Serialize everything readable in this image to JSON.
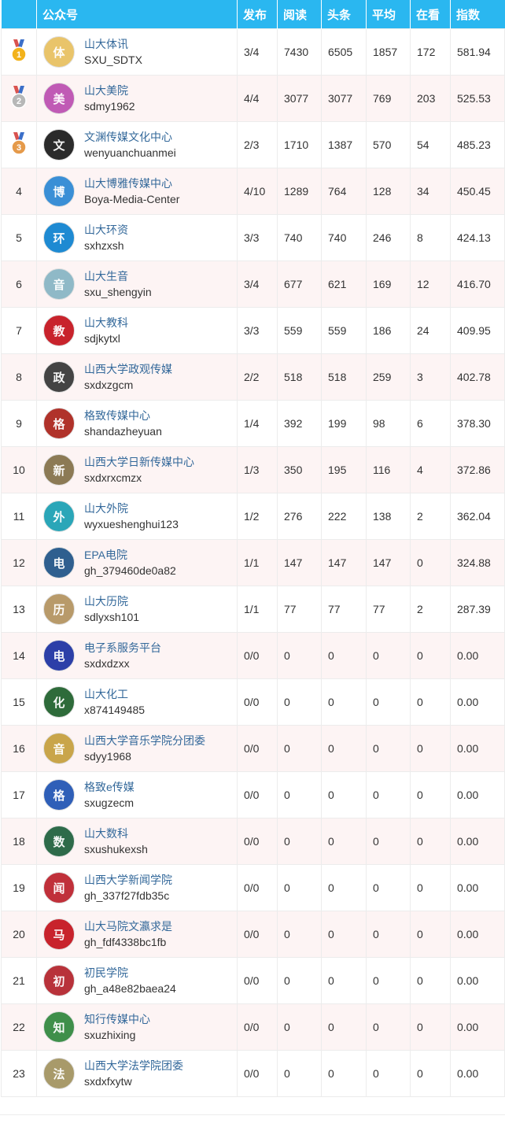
{
  "header": {
    "account": "公众号",
    "publish": "发布",
    "reads": "阅读",
    "headline": "头条",
    "average": "平均",
    "watching": "在看",
    "index": "指数"
  },
  "rows": [
    {
      "rank": "1",
      "medal": "gold",
      "name": "山大体讯",
      "id": "SXU_SDTX",
      "publish": "3/4",
      "reads": "7430",
      "headline": "6505",
      "average": "1857",
      "watching": "172",
      "index": "581.94",
      "avatar_color": "#e9c46a",
      "avatar_glyph": "体"
    },
    {
      "rank": "2",
      "medal": "silver",
      "name": "山大美院",
      "id": "sdmy1962",
      "publish": "4/4",
      "reads": "3077",
      "headline": "3077",
      "average": "769",
      "watching": "203",
      "index": "525.53",
      "avatar_color": "#c05ab5",
      "avatar_glyph": "美"
    },
    {
      "rank": "3",
      "medal": "bronze",
      "name": "文渊传媒文化中心",
      "id": "wenyuanchuanmei",
      "publish": "2/3",
      "reads": "1710",
      "headline": "1387",
      "average": "570",
      "watching": "54",
      "index": "485.23",
      "avatar_color": "#2b2b2b",
      "avatar_glyph": "文"
    },
    {
      "rank": "4",
      "medal": "",
      "name": "山大博雅传媒中心",
      "id": "Boya-Media-Center",
      "publish": "4/10",
      "reads": "1289",
      "headline": "764",
      "average": "128",
      "watching": "34",
      "index": "450.45",
      "avatar_color": "#3a8fd6",
      "avatar_glyph": "博"
    },
    {
      "rank": "5",
      "medal": "",
      "name": "山大环资",
      "id": "sxhzxsh",
      "publish": "3/3",
      "reads": "740",
      "headline": "740",
      "average": "246",
      "watching": "8",
      "index": "424.13",
      "avatar_color": "#1e8ad2",
      "avatar_glyph": "环"
    },
    {
      "rank": "6",
      "medal": "",
      "name": "山大生音",
      "id": "sxu_shengyin",
      "publish": "3/4",
      "reads": "677",
      "headline": "621",
      "average": "169",
      "watching": "12",
      "index": "416.70",
      "avatar_color": "#8fb9c7",
      "avatar_glyph": "音"
    },
    {
      "rank": "7",
      "medal": "",
      "name": "山大教科",
      "id": "sdjkytxl",
      "publish": "3/3",
      "reads": "559",
      "headline": "559",
      "average": "186",
      "watching": "24",
      "index": "409.95",
      "avatar_color": "#c8232c",
      "avatar_glyph": "教"
    },
    {
      "rank": "8",
      "medal": "",
      "name": "山西大学政观传媒",
      "id": "sxdxzgcm",
      "publish": "2/2",
      "reads": "518",
      "headline": "518",
      "average": "259",
      "watching": "3",
      "index": "402.78",
      "avatar_color": "#444444",
      "avatar_glyph": "政"
    },
    {
      "rank": "9",
      "medal": "",
      "name": "格致传媒中心",
      "id": "shandazheyuan",
      "publish": "1/4",
      "reads": "392",
      "headline": "199",
      "average": "98",
      "watching": "6",
      "index": "378.30",
      "avatar_color": "#b0322a",
      "avatar_glyph": "格"
    },
    {
      "rank": "10",
      "medal": "",
      "name": "山西大学日新传媒中心",
      "id": "sxdxrxcmzx",
      "publish": "1/3",
      "reads": "350",
      "headline": "195",
      "average": "116",
      "watching": "4",
      "index": "372.86",
      "avatar_color": "#8c7a55",
      "avatar_glyph": "新"
    },
    {
      "rank": "11",
      "medal": "",
      "name": "山大外院",
      "id": "wyxueshenghui123",
      "publish": "1/2",
      "reads": "276",
      "headline": "222",
      "average": "138",
      "watching": "2",
      "index": "362.04",
      "avatar_color": "#2aa6b8",
      "avatar_glyph": "外"
    },
    {
      "rank": "12",
      "medal": "",
      "name": "EPA电院",
      "id": "gh_379460de0a82",
      "publish": "1/1",
      "reads": "147",
      "headline": "147",
      "average": "147",
      "watching": "0",
      "index": "324.88",
      "avatar_color": "#2f5f8f",
      "avatar_glyph": "电"
    },
    {
      "rank": "13",
      "medal": "",
      "name": "山大历院",
      "id": "sdlyxsh101",
      "publish": "1/1",
      "reads": "77",
      "headline": "77",
      "average": "77",
      "watching": "2",
      "index": "287.39",
      "avatar_color": "#b89a6a",
      "avatar_glyph": "历"
    },
    {
      "rank": "14",
      "medal": "",
      "name": "电子系服务平台",
      "id": "sxdxdzxx",
      "publish": "0/0",
      "reads": "0",
      "headline": "0",
      "average": "0",
      "watching": "0",
      "index": "0.00",
      "avatar_color": "#2c3fa8",
      "avatar_glyph": "电"
    },
    {
      "rank": "15",
      "medal": "",
      "name": "山大化工",
      "id": "x874149485",
      "publish": "0/0",
      "reads": "0",
      "headline": "0",
      "average": "0",
      "watching": "0",
      "index": "0.00",
      "avatar_color": "#2e6b3a",
      "avatar_glyph": "化"
    },
    {
      "rank": "16",
      "medal": "",
      "name": "山西大学音乐学院分团委",
      "id": "sdyy1968",
      "publish": "0/0",
      "reads": "0",
      "headline": "0",
      "average": "0",
      "watching": "0",
      "index": "0.00",
      "avatar_color": "#c9a54a",
      "avatar_glyph": "音"
    },
    {
      "rank": "17",
      "medal": "",
      "name": "格致e传媒",
      "id": "sxugzecm",
      "publish": "0/0",
      "reads": "0",
      "headline": "0",
      "average": "0",
      "watching": "0",
      "index": "0.00",
      "avatar_color": "#2f5fb8",
      "avatar_glyph": "格"
    },
    {
      "rank": "18",
      "medal": "",
      "name": "山大数科",
      "id": "sxushukexsh",
      "publish": "0/0",
      "reads": "0",
      "headline": "0",
      "average": "0",
      "watching": "0",
      "index": "0.00",
      "avatar_color": "#2e6b4a",
      "avatar_glyph": "数"
    },
    {
      "rank": "19",
      "medal": "",
      "name": "山西大学新闻学院",
      "id": "gh_337f27fdb35c",
      "publish": "0/0",
      "reads": "0",
      "headline": "0",
      "average": "0",
      "watching": "0",
      "index": "0.00",
      "avatar_color": "#c0303a",
      "avatar_glyph": "闻"
    },
    {
      "rank": "20",
      "medal": "",
      "name": "山大马院文瀛求是",
      "id": "gh_fdf4338bc1fb",
      "publish": "0/0",
      "reads": "0",
      "headline": "0",
      "average": "0",
      "watching": "0",
      "index": "0.00",
      "avatar_color": "#c8232c",
      "avatar_glyph": "马"
    },
    {
      "rank": "21",
      "medal": "",
      "name": "初民学院",
      "id": "gh_a48e82baea24",
      "publish": "0/0",
      "reads": "0",
      "headline": "0",
      "average": "0",
      "watching": "0",
      "index": "0.00",
      "avatar_color": "#b8323a",
      "avatar_glyph": "初"
    },
    {
      "rank": "22",
      "medal": "",
      "name": "知行传媒中心",
      "id": "sxuzhixing",
      "publish": "0/0",
      "reads": "0",
      "headline": "0",
      "average": "0",
      "watching": "0",
      "index": "0.00",
      "avatar_color": "#3f8f4a",
      "avatar_glyph": "知"
    },
    {
      "rank": "23",
      "medal": "",
      "name": "山西大学法学院团委",
      "id": "sxdxfxytw",
      "publish": "0/0",
      "reads": "0",
      "headline": "0",
      "average": "0",
      "watching": "0",
      "index": "0.00",
      "avatar_color": "#a89a6a",
      "avatar_glyph": "法"
    }
  ],
  "colors": {
    "header_bg": "#2ab7f0",
    "link_blue": "#1d8fd8",
    "name_blue": "#33689a",
    "stripe_pink": "#fdf4f4",
    "gold": "#f2b21b",
    "silver": "#b7b7b7",
    "bronze": "#e59a4a"
  }
}
